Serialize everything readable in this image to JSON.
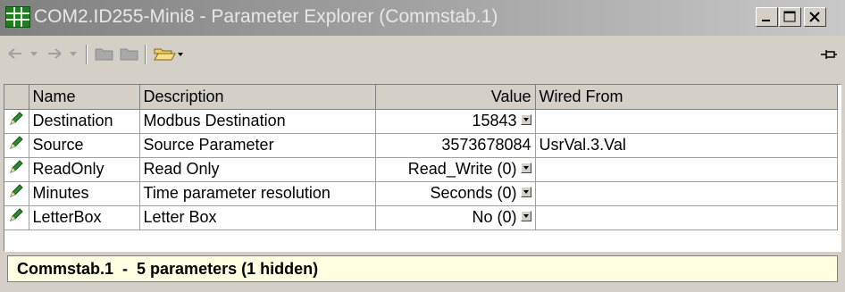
{
  "window": {
    "title": "COM2.ID255-Mini8 - Parameter Explorer (Commstab.1)",
    "buttons": [
      "minimize",
      "maximize",
      "close"
    ]
  },
  "toolbar": {
    "items": [
      {
        "icon": "back-arrow-icon",
        "enabled": false
      },
      {
        "icon": "back-dropdown-icon",
        "enabled": false
      },
      {
        "icon": "forward-arrow-icon",
        "enabled": false
      },
      {
        "icon": "forward-dropdown-icon",
        "enabled": false
      },
      {
        "icon": "folder-icon",
        "enabled": false
      },
      {
        "icon": "folder-icon",
        "enabled": false
      },
      {
        "icon": "open-folder-icon",
        "enabled": true
      },
      {
        "icon": "pin-icon",
        "enabled": true
      }
    ]
  },
  "table": {
    "columns": [
      "Name",
      "Description",
      "Value",
      "Wired From"
    ],
    "rows": [
      {
        "name": "Destination",
        "description": "Modbus Destination",
        "value": "15843",
        "dropdown": true,
        "wired_from": ""
      },
      {
        "name": "Source",
        "description": "Source Parameter",
        "value": "3573678084",
        "dropdown": false,
        "wired_from": "UsrVal.3.Val"
      },
      {
        "name": "ReadOnly",
        "description": "Read Only",
        "value": "Read_Write (0)",
        "dropdown": true,
        "wired_from": ""
      },
      {
        "name": "Minutes",
        "description": "Time parameter resolution",
        "value": "Seconds (0)",
        "dropdown": true,
        "wired_from": ""
      },
      {
        "name": "LetterBox",
        "description": "Letter Box",
        "value": "No (0)",
        "dropdown": true,
        "wired_from": ""
      }
    ]
  },
  "status": {
    "text": "Commstab.1  -  5 parameters (1 hidden)"
  },
  "colors": {
    "edit_pencil": "#2e8b2e",
    "status_background": "#ffffe1"
  }
}
